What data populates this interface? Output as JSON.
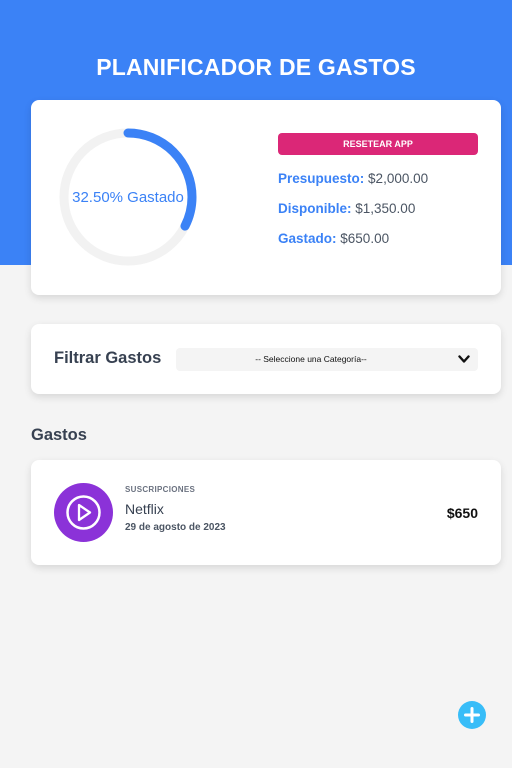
{
  "header": {
    "title": "PLANIFICADOR DE GASTOS",
    "color": "#3b82f6"
  },
  "budget": {
    "progress_percent": 32.5,
    "progress_label": "32.50% Gastado",
    "reset_label": "RESETEAR APP",
    "reset_color": "#db2777",
    "budget_label": "Presupuesto:",
    "budget_value": "$2,000.00",
    "available_label": "Disponible:",
    "available_value": "$1,350.00",
    "spent_label": "Gastado:",
    "spent_value": "$650.00"
  },
  "filter": {
    "label": "Filtrar Gastos",
    "selected": "-- Seleccione una Categoría--"
  },
  "expenses": {
    "title": "Gastos",
    "items": [
      {
        "category": "SUSCRIPCIONES",
        "name": "Netflix",
        "date": "29 de agosto de 2023",
        "amount": "$650",
        "icon": "play-icon",
        "icon_color": "#8b32d8"
      }
    ]
  },
  "fab": {
    "icon": "plus-icon",
    "color": "#38bdf8"
  }
}
